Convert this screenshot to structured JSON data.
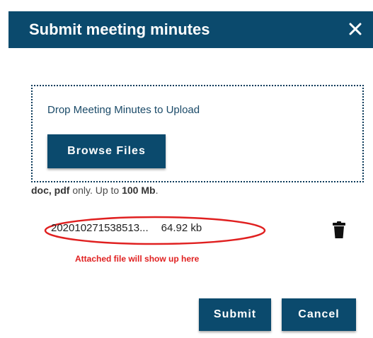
{
  "dialog": {
    "title": "Submit meeting minutes",
    "close_icon": "close-icon"
  },
  "upload": {
    "drop_text": "Drop Meeting Minutes to Upload",
    "browse_label": "Browse Files",
    "hint_types": "doc, pdf",
    "hint_mid": " only. Up to ",
    "hint_size": "100 Mb",
    "hint_end": "."
  },
  "attachment": {
    "file_name": "202010271538513...",
    "file_size": "64.92 kb",
    "delete_icon": "trash-icon",
    "annotation": "Attached file will show up here"
  },
  "actions": {
    "submit_label": "Submit",
    "cancel_label": "Cancel"
  },
  "colors": {
    "brand": "#0b4a6d",
    "annotation": "#e02020"
  }
}
